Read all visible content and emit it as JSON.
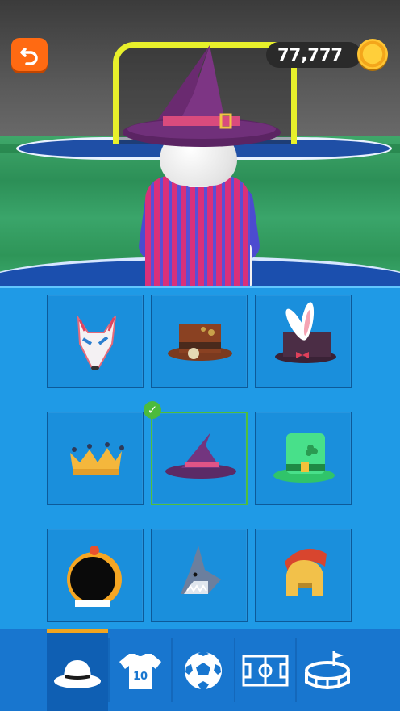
{
  "hud": {
    "coins": "77,777",
    "icons": {
      "back": "undo-arrow-icon",
      "coin": "coin-icon"
    }
  },
  "colors": {
    "accent": "#ff6a12",
    "panel": "#1f9ae6",
    "tabbar": "#1876cf",
    "tab_active_indicator": "#f2a51f",
    "selected": "#4cbb3c"
  },
  "items": [
    {
      "name": "fox-mask"
    },
    {
      "name": "steampunk-top-hat"
    },
    {
      "name": "bunny-ear-top-hat"
    },
    {
      "name": "crown"
    },
    {
      "name": "witch-hat",
      "selected": true
    },
    {
      "name": "leprechaun-hat"
    },
    {
      "name": "astronaut-helmet"
    },
    {
      "name": "shark-hat"
    },
    {
      "name": "spartan-helmet"
    }
  ],
  "tabs": [
    {
      "name": "hats",
      "icon": "hat-icon",
      "active": true
    },
    {
      "name": "kits",
      "icon": "jersey-icon",
      "jersey_number": "10"
    },
    {
      "name": "balls",
      "icon": "soccer-ball-icon"
    },
    {
      "name": "fields",
      "icon": "pitch-icon"
    },
    {
      "name": "stadiums",
      "icon": "stadium-icon"
    }
  ]
}
